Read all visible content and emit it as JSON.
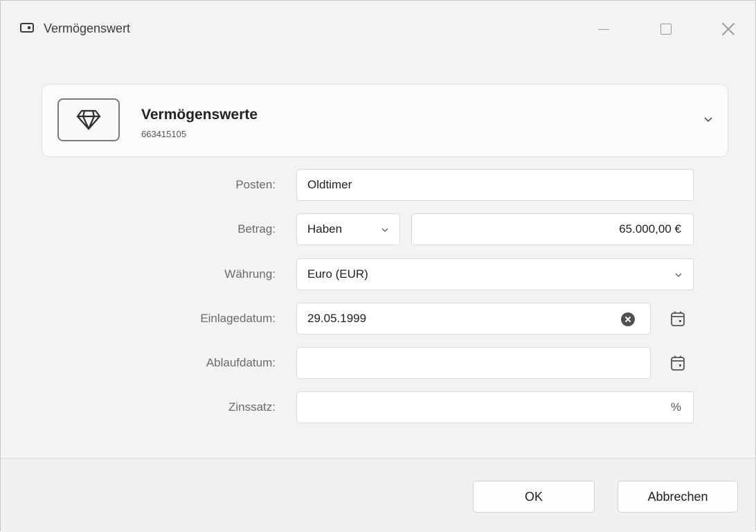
{
  "window": {
    "title": "Vermögenswert",
    "app_icon": "wallet-icon"
  },
  "account": {
    "title": "Vermögenswerte",
    "number": "663415105",
    "icon": "diamond-icon"
  },
  "form": {
    "posten_label": "Posten:",
    "posten_value": "Oldtimer",
    "betrag_label": "Betrag:",
    "betrag_type": "Haben",
    "betrag_value": "65.000,00 €",
    "waehrung_label": "Währung:",
    "waehrung_value": "Euro (EUR)",
    "einlagedatum_label": "Einlagedatum:",
    "einlagedatum_value": "29.05.1999",
    "ablaufdatum_label": "Ablaufdatum:",
    "ablaufdatum_value": "",
    "zinssatz_label": "Zinssatz:",
    "zinssatz_value": "",
    "zinssatz_unit": "%"
  },
  "buttons": {
    "ok": "OK",
    "cancel": "Abbrechen"
  }
}
